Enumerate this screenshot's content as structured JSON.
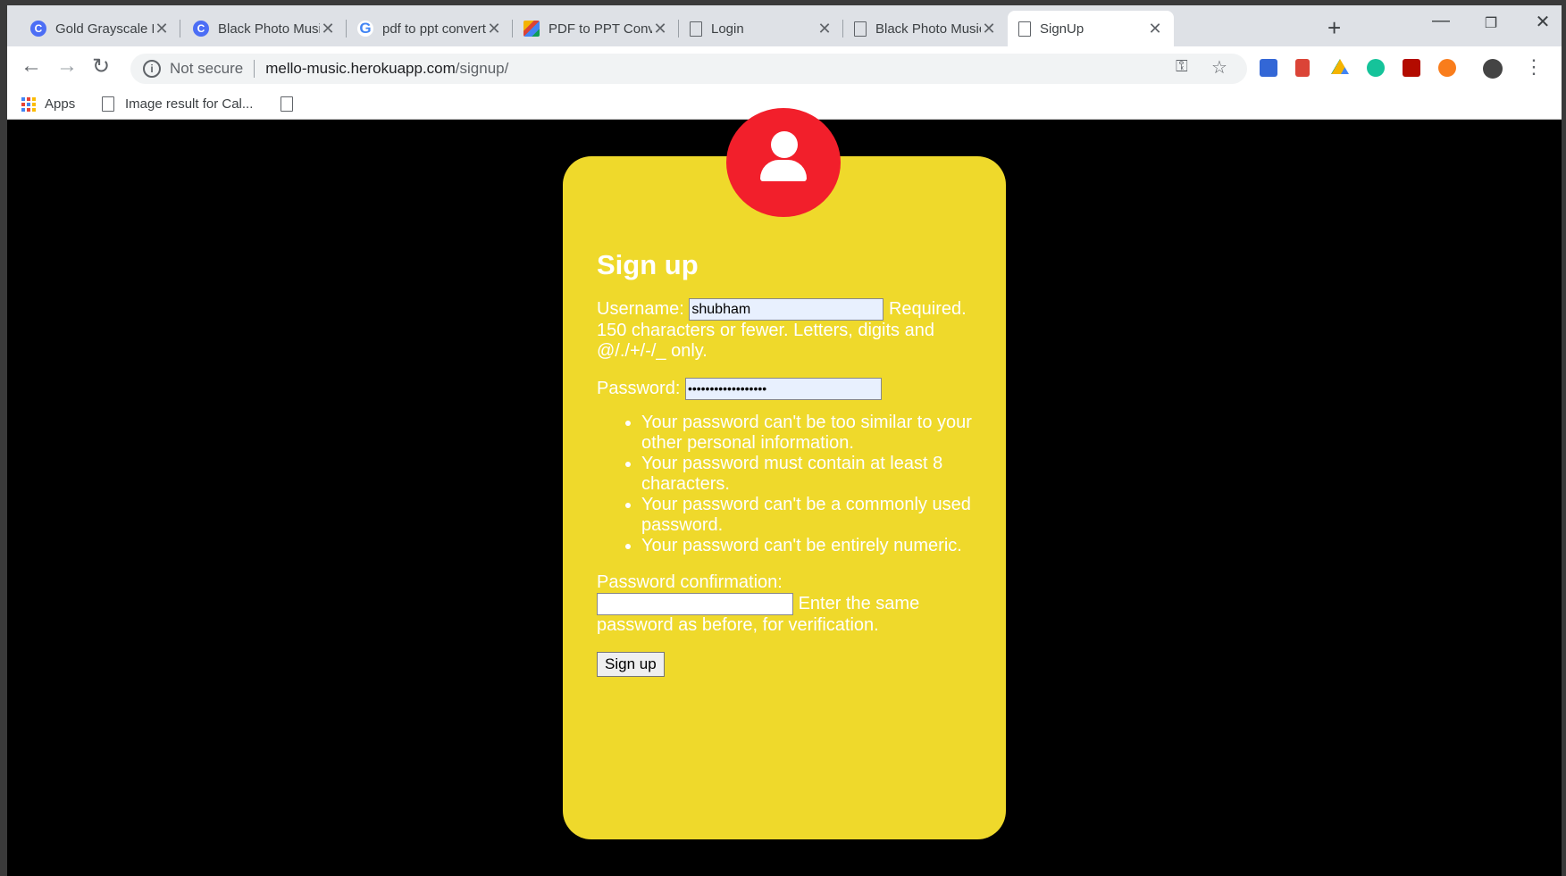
{
  "tabs": [
    {
      "title": "Gold Grayscale Big",
      "icon": "c-circle-icon",
      "active": false
    },
    {
      "title": "Black Photo Music",
      "icon": "c-circle-icon",
      "active": false
    },
    {
      "title": "pdf to ppt convert",
      "icon": "google-icon",
      "active": false
    },
    {
      "title": "PDF to PPT Conve",
      "icon": "colorful-grid-icon",
      "active": false
    },
    {
      "title": "Login",
      "icon": "page-icon",
      "active": false
    },
    {
      "title": "Black Photo Music",
      "icon": "page-icon",
      "active": false
    },
    {
      "title": "SignUp",
      "icon": "page-icon",
      "active": true
    }
  ],
  "toolbar": {
    "not_secure": "Not secure",
    "url_host": "mello-music.herokuapp.com",
    "url_path": "/signup/"
  },
  "bookmarks": {
    "apps": "Apps",
    "item1": "Image result for Cal..."
  },
  "form": {
    "title": "Sign up",
    "username_label": "Username:",
    "username_value": "shubham",
    "username_help_1": "Required.",
    "username_help_2": "150 characters or fewer. Letters, digits and @/./+/-/_ only.",
    "password_label": "Password:",
    "password_value": "••••••••••••••••••",
    "password_rules": [
      "Your password can't be too similar to your other personal information.",
      "Your password must contain at least 8 characters.",
      "Your password can't be a commonly used password.",
      "Your password can't be entirely numeric."
    ],
    "confirm_label": "Password confirmation:",
    "confirm_help": "Enter the same password as before, for verification.",
    "submit_label": "Sign up"
  },
  "colors": {
    "card": "#efd92b",
    "avatar": "#f21f2b",
    "background": "#000000"
  }
}
